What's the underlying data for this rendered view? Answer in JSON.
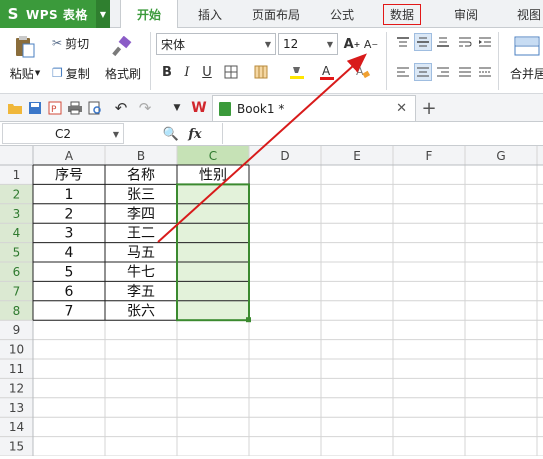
{
  "app": {
    "name": "WPS 表格"
  },
  "tabs": [
    {
      "label": "开始"
    },
    {
      "label": "插入"
    },
    {
      "label": "页面布局"
    },
    {
      "label": "公式"
    },
    {
      "label": "数据"
    },
    {
      "label": "审阅"
    },
    {
      "label": "视图"
    }
  ],
  "ribbon": {
    "paste": "粘贴",
    "cut": "剪切",
    "copy": "复制",
    "format_painter": "格式刷",
    "font_name": "宋体",
    "font_size": "12",
    "merge": "合并居"
  },
  "document": {
    "tab_title": "Book1 *"
  },
  "formula_bar": {
    "name_box": "C2",
    "fx": "fx"
  },
  "grid": {
    "columns": [
      "A",
      "B",
      "C",
      "D",
      "E",
      "F",
      "G"
    ],
    "row_numbers": [
      "1",
      "2",
      "3",
      "4",
      "5",
      "6",
      "7",
      "8",
      "9",
      "10",
      "11",
      "12",
      "13",
      "14",
      "15"
    ],
    "header_row": [
      "序号",
      "名称",
      "性别"
    ],
    "rows": [
      [
        "1",
        "张三",
        ""
      ],
      [
        "2",
        "李四",
        ""
      ],
      [
        "3",
        "王二",
        ""
      ],
      [
        "4",
        "马五",
        ""
      ],
      [
        "5",
        "牛七",
        ""
      ],
      [
        "6",
        "李五",
        ""
      ],
      [
        "7",
        "张六",
        ""
      ]
    ]
  },
  "colors": {
    "accent": "#3b9a3b",
    "highlight_box": "#e21818",
    "selection_fill": "#e3f2da",
    "arrow": "#d81b1b"
  },
  "icons": [
    "wps-logo-icon",
    "paste-icon",
    "scissors-icon",
    "copy-icon",
    "brush-icon",
    "bold-icon",
    "italic-icon",
    "underline-icon",
    "border-icon",
    "fill-color-icon",
    "font-color-icon",
    "grow-font-icon",
    "shrink-font-icon",
    "align-icon",
    "open-folder-icon",
    "save-icon",
    "pdf-icon",
    "print-icon",
    "undo-icon",
    "redo-icon",
    "close-icon",
    "plus-icon",
    "zoom-icon"
  ]
}
